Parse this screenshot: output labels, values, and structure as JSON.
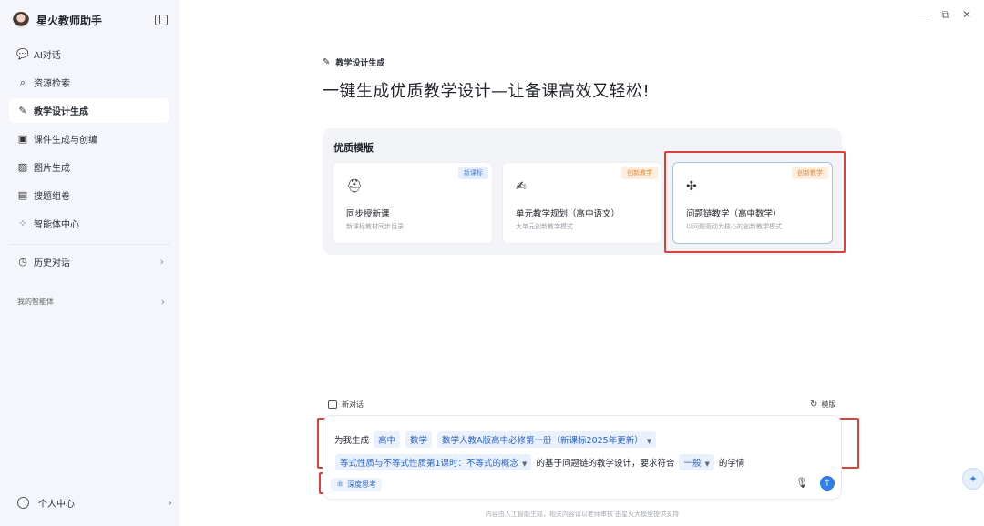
{
  "app": {
    "name": "星火教师助手"
  },
  "sidebar": {
    "items": [
      {
        "label": "AI对话",
        "icon": "chat-icon"
      },
      {
        "label": "资源检索",
        "icon": "search-icon"
      },
      {
        "label": "教学设计生成",
        "icon": "pen-icon",
        "active": true
      },
      {
        "label": "课件生成与创编",
        "icon": "slides-icon"
      },
      {
        "label": "图片生成",
        "icon": "image-icon"
      },
      {
        "label": "搜题组卷",
        "icon": "exam-icon"
      },
      {
        "label": "智能体中心",
        "icon": "agents-icon"
      }
    ],
    "history": {
      "label": "历史对话",
      "icon": "clock-icon"
    },
    "my_agents": "我的智能体",
    "user": {
      "label": "个人中心"
    }
  },
  "window_controls": {
    "minimize": "—",
    "restore": "⧉",
    "close": "✕"
  },
  "main": {
    "section": "教学设计生成",
    "headline": "一键生成优质教学设计—让备课高效又轻松!",
    "templates": {
      "title": "优质模版",
      "cards": [
        {
          "name": "同步授新课",
          "desc": "新课标教材同步目录",
          "badge": "新课标"
        },
        {
          "name": "单元教学规划（高中语文）",
          "desc": "大单元创新教学模式",
          "badge": "创新教学"
        },
        {
          "name": "问题链教学（高中数学）",
          "desc": "以问题驱动为核心的创新教学模式",
          "badge": "创新教学"
        }
      ]
    }
  },
  "composer": {
    "new_chat": "新对话",
    "template_toggle": "模版",
    "prefix": "为我生成",
    "chips_line1": [
      "高中",
      "数学",
      "数学人教A版高中必修第一册（新课标2025年更新）"
    ],
    "chip_lesson": "等式性质与不等式性质第1课时：不等式的概念",
    "middle_text": "的基于问题链的教学设计，要求符合",
    "chip_level": "一般",
    "suffix": "的学情",
    "deep_think": "深度思考",
    "disclaimer": "内容由人工智能生成，相关内容请以老师审核  由星火大模型提供支持"
  },
  "colors": {
    "accent": "#2f7fe6",
    "highlight": "#e0403a",
    "sidebar_bg": "#f4f6fb"
  }
}
